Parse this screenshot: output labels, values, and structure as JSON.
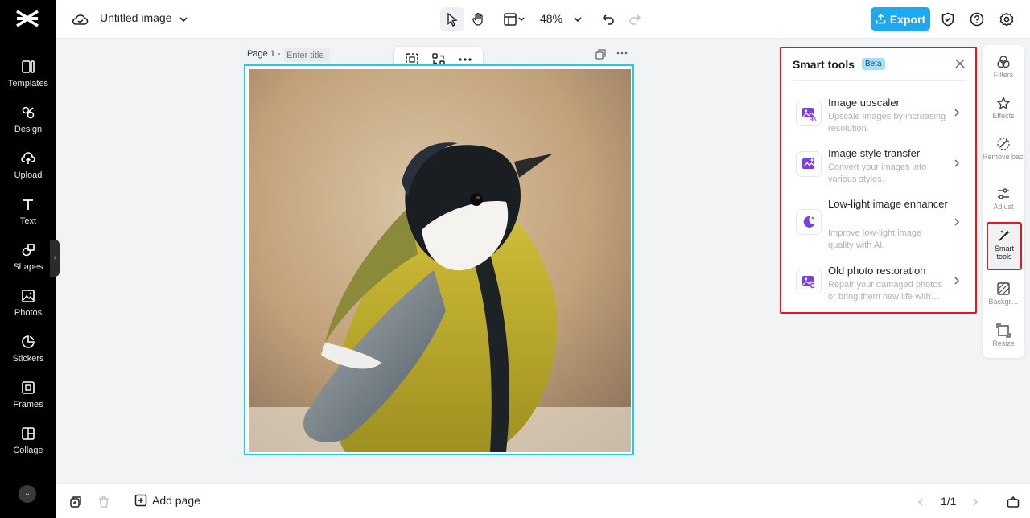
{
  "app": {
    "name": "CapCut"
  },
  "topbar": {
    "doc_title": "Untitled image",
    "zoom": "48%",
    "export_label": "Export"
  },
  "sidebar": {
    "items": [
      {
        "label": "Templates",
        "icon": "templates-icon"
      },
      {
        "label": "Design",
        "icon": "design-icon"
      },
      {
        "label": "Upload",
        "icon": "upload-icon"
      },
      {
        "label": "Text",
        "icon": "text-icon"
      },
      {
        "label": "Shapes",
        "icon": "shapes-icon"
      },
      {
        "label": "Photos",
        "icon": "photos-icon"
      },
      {
        "label": "Stickers",
        "icon": "stickers-icon"
      },
      {
        "label": "Frames",
        "icon": "frames-icon"
      },
      {
        "label": "Collage",
        "icon": "collage-icon"
      }
    ]
  },
  "canvas": {
    "page_label": "Page 1 -",
    "title_placeholder": "Enter title"
  },
  "bottombar": {
    "add_page_label": "Add page",
    "pager": "1/1"
  },
  "smart_panel": {
    "title": "Smart tools",
    "badge": "Beta",
    "tools": [
      {
        "name": "Image upscaler",
        "desc": "Upscale images by increasing resolution."
      },
      {
        "name": "Image style transfer",
        "desc": "Convert your images into various styles."
      },
      {
        "name": "Low-light image enhancer",
        "desc": "Improve low-light image quality with AI."
      },
      {
        "name": "Old photo restoration",
        "desc": "Repair your damaged photos or bring them new life with…"
      }
    ]
  },
  "rail": {
    "items": [
      {
        "label": "Filters"
      },
      {
        "label": "Effects"
      },
      {
        "label": "Remove backgr…"
      },
      {
        "label": "Adjust"
      },
      {
        "label": "Smart tools"
      },
      {
        "label": "Backgr…"
      },
      {
        "label": "Resize"
      }
    ]
  },
  "colors": {
    "accent": "#1fa8f0",
    "highlight": "#e0191e",
    "canvas_border": "#28c8e0",
    "tool_icon": "#7b3fe4"
  }
}
